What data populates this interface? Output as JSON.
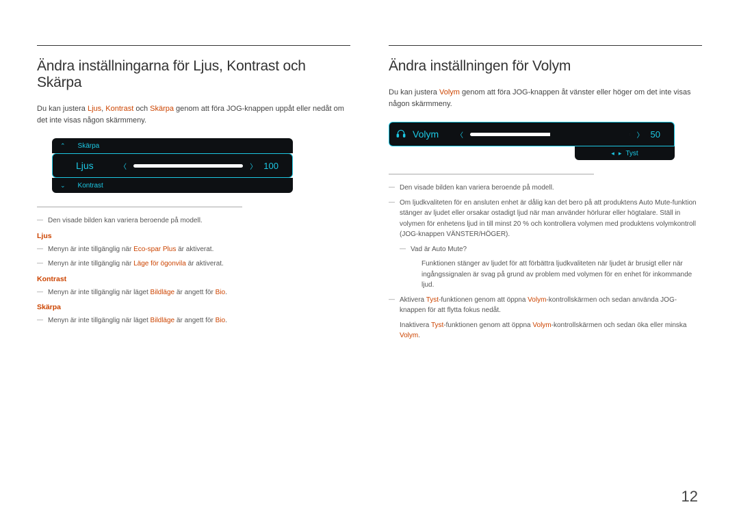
{
  "page_number": "12",
  "left": {
    "heading": "Ändra inställningarna för Ljus, Kontrast och Skärpa",
    "intro_pre": "Du kan justera ",
    "intro_terms": {
      "t1": "Ljus",
      "sep1": ", ",
      "t2": "Kontrast",
      "sep2": " och ",
      "t3": "Skärpa"
    },
    "intro_post": " genom att föra JOG-knappen uppåt eller nedåt om det inte visas någon skärmmeny.",
    "osd": {
      "top_label": "Skärpa",
      "main_label": "Ljus",
      "main_value": "100",
      "bottom_label": "Kontrast"
    },
    "note1": "Den visade bilden kan variera beroende på modell.",
    "sec_ljus": {
      "label": "Ljus",
      "n1_pre": "Menyn är inte tillgänglig när ",
      "n1_hl": "Eco-spar Plus",
      "n1_post": " är aktiverat.",
      "n2_pre": "Menyn är inte tillgänglig när ",
      "n2_hl": "Läge för ögonvila",
      "n2_post": " är aktiverat."
    },
    "sec_kontrast": {
      "label": "Kontrast",
      "n_pre": "Menyn är inte tillgänglig när läget ",
      "n_hl1": "Bildläge",
      "n_mid": " är angett för ",
      "n_hl2": "Bio",
      "n_post": "."
    },
    "sec_skarpa": {
      "label": "Skärpa",
      "n_pre": "Menyn är inte tillgänglig när läget ",
      "n_hl1": "Bildläge",
      "n_mid": " är angett för ",
      "n_hl2": "Bio",
      "n_post": "."
    }
  },
  "right": {
    "heading": "Ändra inställningen för Volym",
    "intro_pre": "Du kan justera ",
    "intro_hl": "Volym",
    "intro_post": " genom att föra JOG-knappen åt vänster eller höger om det inte visas någon skärmmeny.",
    "osd": {
      "main_label": "Volym",
      "main_value": "50",
      "sub_label": "Tyst"
    },
    "note1": "Den visade bilden kan variera beroende på modell.",
    "note2": "Om ljudkvaliteten för en ansluten enhet är dålig kan det bero på att produktens Auto Mute-funktion stänger av ljudet eller orsakar ostadigt ljud när man använder hörlurar eller högtalare. Ställ in volymen för enhetens ljud in till minst 20 % och kontrollera volymen med produktens volymkontroll (JOG-knappen VÄNSTER/HÖGER).",
    "note2a_q": "Vad är Auto Mute?",
    "note2a_a": "Funktionen stänger av ljudet för att förbättra ljudkvaliteten när ljudet är brusigt eller när ingångssignalen är svag på grund av problem med volymen för en enhet för inkommande ljud.",
    "note3_pre": "Aktivera ",
    "note3_hl1": "Tyst",
    "note3_mid1": "-funktionen genom att öppna ",
    "note3_hl2": "Volym",
    "note3_post": "-kontrollskärmen och sedan använda JOG-knappen för att flytta fokus nedåt.",
    "note3b_pre": "Inaktivera ",
    "note3b_hl1": "Tyst",
    "note3b_mid1": "-funktionen genom att öppna ",
    "note3b_hl2": "Volym",
    "note3b_mid2": "-kontrollskärmen och sedan öka eller minska ",
    "note3b_hl3": "Volym",
    "note3b_post": "."
  }
}
